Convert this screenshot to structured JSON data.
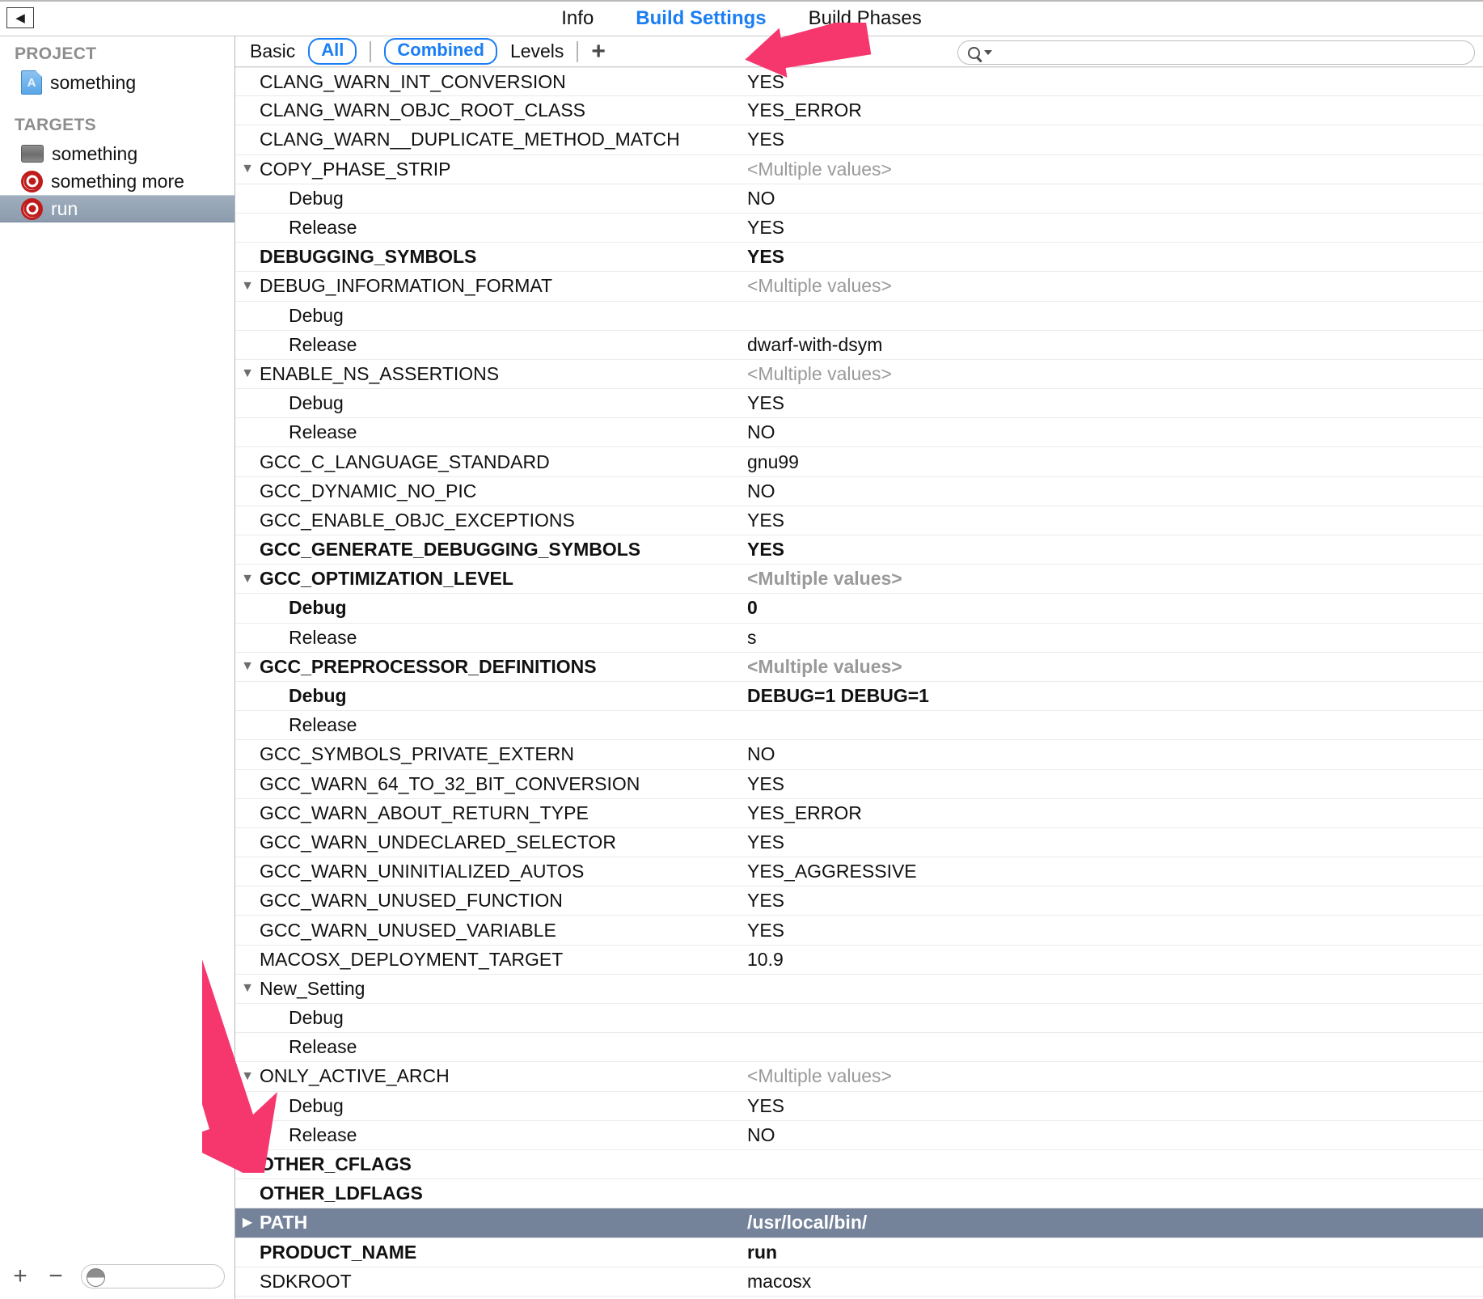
{
  "window": {
    "back_button_glyph": "◀"
  },
  "tabs": [
    {
      "label": "Info",
      "active": false
    },
    {
      "label": "Build Settings",
      "active": true
    },
    {
      "label": "Build Phases",
      "active": false
    }
  ],
  "sidebar": {
    "project_header": "PROJECT",
    "project_items": [
      {
        "label": "something",
        "icon": "app-project-icon"
      }
    ],
    "targets_header": "TARGETS",
    "target_items": [
      {
        "label": "something",
        "icon": "app-bundle-icon",
        "selected": false
      },
      {
        "label": "something more",
        "icon": "target-icon",
        "selected": false
      },
      {
        "label": "run",
        "icon": "target-icon",
        "selected": true
      }
    ],
    "toolbar": {
      "add_label": "+",
      "remove_label": "−",
      "filter_placeholder": ""
    }
  },
  "scopebar": {
    "basic_label": "Basic",
    "all_label": "All",
    "combined_label": "Combined",
    "levels_label": "Levels",
    "add_label": "+",
    "search_placeholder": ""
  },
  "colors": {
    "accent_blue": "#1a7ef4",
    "selection_blue_gray": "#74839a",
    "sidebar_selection": "#8c9cae",
    "multiple_values_gray": "#9a9a9a",
    "arrow_magenta": "#f6376e"
  },
  "settings_rows": [
    {
      "name": "CLANG_WARN_INT_CONVERSION",
      "value": "YES",
      "level": 0,
      "bold": false,
      "disclosure": "",
      "multiple": false,
      "selected": false
    },
    {
      "name": "CLANG_WARN_OBJC_ROOT_CLASS",
      "value": "YES_ERROR",
      "level": 0,
      "bold": false,
      "disclosure": "",
      "multiple": false,
      "selected": false
    },
    {
      "name": "CLANG_WARN__DUPLICATE_METHOD_MATCH",
      "value": "YES",
      "level": 0,
      "bold": false,
      "disclosure": "",
      "multiple": false,
      "selected": false
    },
    {
      "name": "COPY_PHASE_STRIP",
      "value": "<Multiple values>",
      "level": 0,
      "bold": false,
      "disclosure": "▼",
      "multiple": true,
      "selected": false
    },
    {
      "name": "Debug",
      "value": "NO",
      "level": 1,
      "bold": false,
      "disclosure": "",
      "multiple": false,
      "selected": false
    },
    {
      "name": "Release",
      "value": "YES",
      "level": 1,
      "bold": false,
      "disclosure": "",
      "multiple": false,
      "selected": false
    },
    {
      "name": "DEBUGGING_SYMBOLS",
      "value": "YES",
      "level": 0,
      "bold": true,
      "disclosure": "",
      "multiple": false,
      "selected": false
    },
    {
      "name": "DEBUG_INFORMATION_FORMAT",
      "value": "<Multiple values>",
      "level": 0,
      "bold": false,
      "disclosure": "▼",
      "multiple": true,
      "selected": false
    },
    {
      "name": "Debug",
      "value": "",
      "level": 1,
      "bold": false,
      "disclosure": "",
      "multiple": false,
      "selected": false
    },
    {
      "name": "Release",
      "value": "dwarf-with-dsym",
      "level": 1,
      "bold": false,
      "disclosure": "",
      "multiple": false,
      "selected": false
    },
    {
      "name": "ENABLE_NS_ASSERTIONS",
      "value": "<Multiple values>",
      "level": 0,
      "bold": false,
      "disclosure": "▼",
      "multiple": true,
      "selected": false
    },
    {
      "name": "Debug",
      "value": "YES",
      "level": 1,
      "bold": false,
      "disclosure": "",
      "multiple": false,
      "selected": false
    },
    {
      "name": "Release",
      "value": "NO",
      "level": 1,
      "bold": false,
      "disclosure": "",
      "multiple": false,
      "selected": false
    },
    {
      "name": "GCC_C_LANGUAGE_STANDARD",
      "value": "gnu99",
      "level": 0,
      "bold": false,
      "disclosure": "",
      "multiple": false,
      "selected": false
    },
    {
      "name": "GCC_DYNAMIC_NO_PIC",
      "value": "NO",
      "level": 0,
      "bold": false,
      "disclosure": "",
      "multiple": false,
      "selected": false
    },
    {
      "name": "GCC_ENABLE_OBJC_EXCEPTIONS",
      "value": "YES",
      "level": 0,
      "bold": false,
      "disclosure": "",
      "multiple": false,
      "selected": false
    },
    {
      "name": "GCC_GENERATE_DEBUGGING_SYMBOLS",
      "value": "YES",
      "level": 0,
      "bold": true,
      "disclosure": "",
      "multiple": false,
      "selected": false
    },
    {
      "name": "GCC_OPTIMIZATION_LEVEL",
      "value": "<Multiple values>",
      "level": 0,
      "bold": true,
      "disclosure": "▼",
      "multiple": true,
      "selected": false
    },
    {
      "name": "Debug",
      "value": "0",
      "level": 1,
      "bold": true,
      "disclosure": "",
      "multiple": false,
      "selected": false
    },
    {
      "name": "Release",
      "value": "s",
      "level": 1,
      "bold": false,
      "disclosure": "",
      "multiple": false,
      "selected": false
    },
    {
      "name": "GCC_PREPROCESSOR_DEFINITIONS",
      "value": "<Multiple values>",
      "level": 0,
      "bold": true,
      "disclosure": "▼",
      "multiple": true,
      "selected": false
    },
    {
      "name": "Debug",
      "value": "DEBUG=1 DEBUG=1",
      "level": 1,
      "bold": true,
      "disclosure": "",
      "multiple": false,
      "selected": false
    },
    {
      "name": "Release",
      "value": "",
      "level": 1,
      "bold": false,
      "disclosure": "",
      "multiple": false,
      "selected": false
    },
    {
      "name": "GCC_SYMBOLS_PRIVATE_EXTERN",
      "value": "NO",
      "level": 0,
      "bold": false,
      "disclosure": "",
      "multiple": false,
      "selected": false
    },
    {
      "name": "GCC_WARN_64_TO_32_BIT_CONVERSION",
      "value": "YES",
      "level": 0,
      "bold": false,
      "disclosure": "",
      "multiple": false,
      "selected": false
    },
    {
      "name": "GCC_WARN_ABOUT_RETURN_TYPE",
      "value": "YES_ERROR",
      "level": 0,
      "bold": false,
      "disclosure": "",
      "multiple": false,
      "selected": false
    },
    {
      "name": "GCC_WARN_UNDECLARED_SELECTOR",
      "value": "YES",
      "level": 0,
      "bold": false,
      "disclosure": "",
      "multiple": false,
      "selected": false
    },
    {
      "name": "GCC_WARN_UNINITIALIZED_AUTOS",
      "value": "YES_AGGRESSIVE",
      "level": 0,
      "bold": false,
      "disclosure": "",
      "multiple": false,
      "selected": false
    },
    {
      "name": "GCC_WARN_UNUSED_FUNCTION",
      "value": "YES",
      "level": 0,
      "bold": false,
      "disclosure": "",
      "multiple": false,
      "selected": false
    },
    {
      "name": "GCC_WARN_UNUSED_VARIABLE",
      "value": "YES",
      "level": 0,
      "bold": false,
      "disclosure": "",
      "multiple": false,
      "selected": false
    },
    {
      "name": "MACOSX_DEPLOYMENT_TARGET",
      "value": "10.9",
      "level": 0,
      "bold": false,
      "disclosure": "",
      "multiple": false,
      "selected": false
    },
    {
      "name": "New_Setting",
      "value": "",
      "level": 0,
      "bold": false,
      "disclosure": "▼",
      "multiple": false,
      "selected": false
    },
    {
      "name": "Debug",
      "value": "",
      "level": 1,
      "bold": false,
      "disclosure": "",
      "multiple": false,
      "selected": false
    },
    {
      "name": "Release",
      "value": "",
      "level": 1,
      "bold": false,
      "disclosure": "",
      "multiple": false,
      "selected": false
    },
    {
      "name": "ONLY_ACTIVE_ARCH",
      "value": "<Multiple values>",
      "level": 0,
      "bold": false,
      "disclosure": "▼",
      "multiple": true,
      "selected": false
    },
    {
      "name": "Debug",
      "value": "YES",
      "level": 1,
      "bold": false,
      "disclosure": "",
      "multiple": false,
      "selected": false
    },
    {
      "name": "Release",
      "value": "NO",
      "level": 1,
      "bold": false,
      "disclosure": "",
      "multiple": false,
      "selected": false
    },
    {
      "name": "OTHER_CFLAGS",
      "value": "",
      "level": 0,
      "bold": true,
      "disclosure": "",
      "multiple": false,
      "selected": false
    },
    {
      "name": "OTHER_LDFLAGS",
      "value": "",
      "level": 0,
      "bold": true,
      "disclosure": "",
      "multiple": false,
      "selected": false
    },
    {
      "name": "PATH",
      "value": "/usr/local/bin/",
      "level": 0,
      "bold": true,
      "disclosure": "▶",
      "multiple": false,
      "selected": true
    },
    {
      "name": "PRODUCT_NAME",
      "value": "run",
      "level": 0,
      "bold": true,
      "disclosure": "",
      "multiple": false,
      "selected": false
    },
    {
      "name": "SDKROOT",
      "value": "macosx",
      "level": 0,
      "bold": false,
      "disclosure": "",
      "multiple": false,
      "selected": false
    }
  ],
  "annotations": [
    {
      "name": "arrow-pointing-to-add-setting-button",
      "direction": "left"
    },
    {
      "name": "arrow-pointing-to-path-row",
      "direction": "down-right"
    }
  ]
}
